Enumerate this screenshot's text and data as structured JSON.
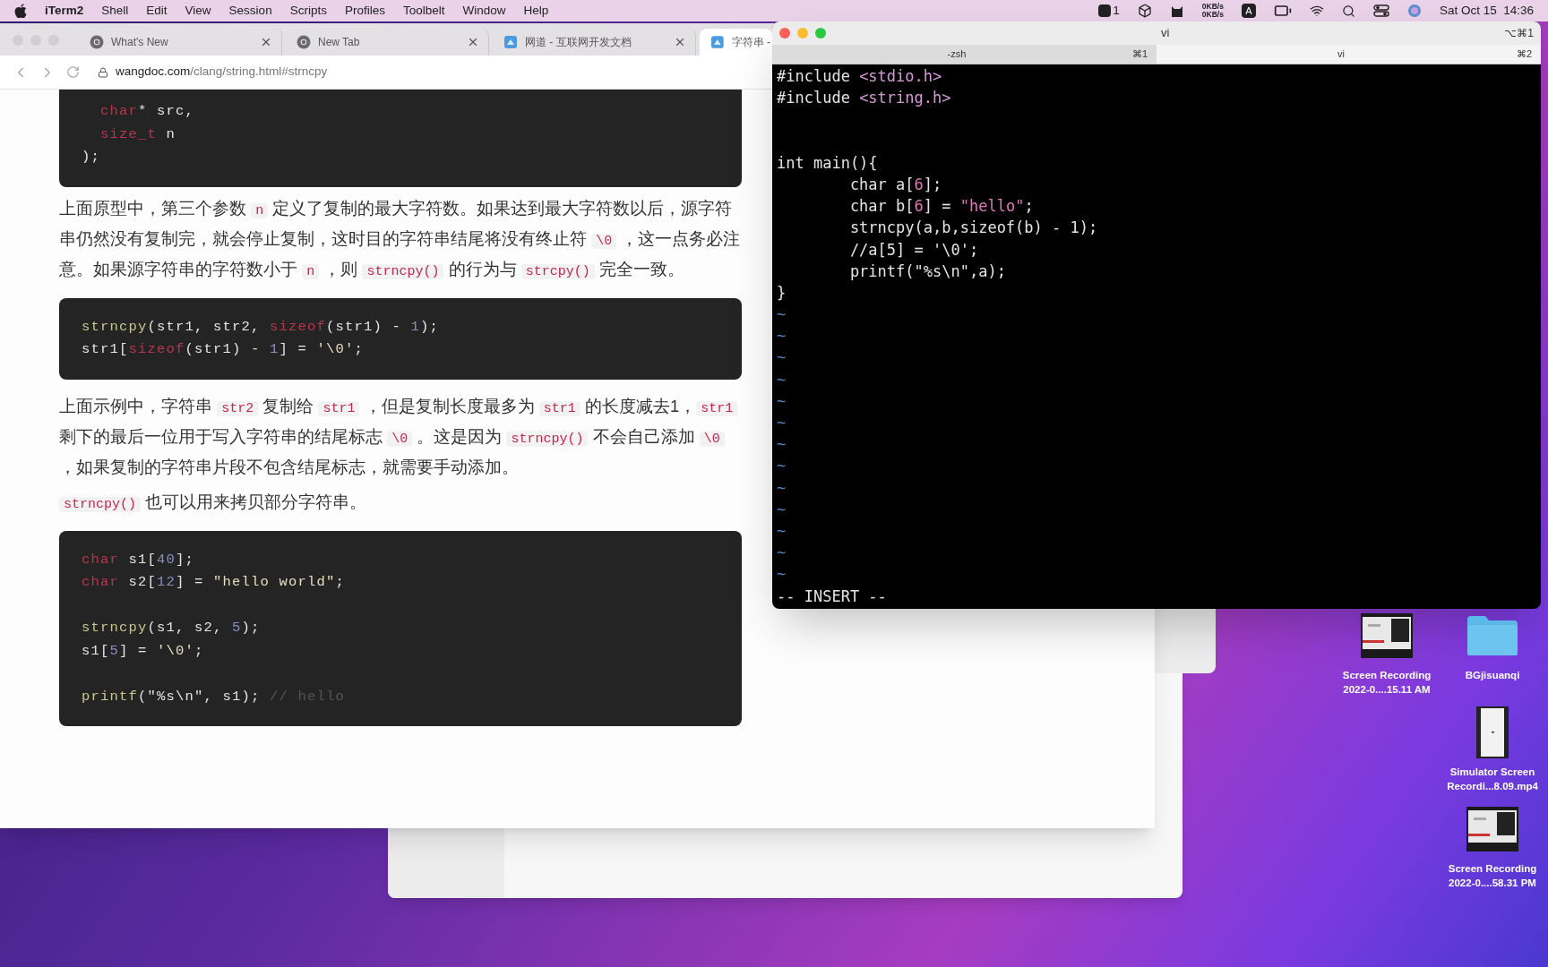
{
  "menu_bar": {
    "app": "iTerm2",
    "menus": [
      "Shell",
      "Edit",
      "View",
      "Session",
      "Scripts",
      "Profiles",
      "Toolbelt",
      "Window",
      "Help"
    ],
    "badge": "1",
    "net_up": "0KB/s",
    "net_down": "0KB/s",
    "keyboard": "A",
    "clock": "Sat Oct 15  14:36"
  },
  "browser": {
    "tabs": [
      {
        "title": "What's New",
        "kind": "chrome",
        "selected": false
      },
      {
        "title": "New Tab",
        "kind": "chrome",
        "selected": false
      },
      {
        "title": "网道 - 互联网开发文档",
        "kind": "doc",
        "selected": false
      },
      {
        "title": "字符串 -",
        "kind": "doc",
        "selected": true
      }
    ],
    "url_host": "wangdoc.com",
    "url_path": "/clang/string.html#strncpy",
    "blocks": [
      {
        "kind": "code",
        "groups": [
          [
            [
              {
                "text": "  char",
                "kind": "kw"
              },
              {
                "text": "* src,",
                "kind": "p"
              }
            ],
            [
              {
                "text": "  size_t",
                "kind": "kw"
              },
              {
                "text": " n",
                "kind": "p"
              }
            ],
            [
              {
                "text": ");",
                "kind": "p"
              }
            ]
          ]
        ]
      },
      {
        "kind": "paragraph",
        "segments": [
          {
            "text": "上面原型中，第三个参数 ",
            "kind": "text"
          },
          {
            "text": "n",
            "kind": "code"
          },
          {
            "text": " 定义了复制的最大字符数。如果达到最大字符数以后，源字符串仍然没有复制完，就会停止复制，这时目的字符串结尾将没有终止符 ",
            "kind": "text"
          },
          {
            "text": "\\0",
            "kind": "code"
          },
          {
            "text": " ，这一点务必注意。如果源字符串的字符数小于 ",
            "kind": "text"
          },
          {
            "text": "n",
            "kind": "code"
          },
          {
            "text": " ，则 ",
            "kind": "text"
          },
          {
            "text": "strncpy()",
            "kind": "code"
          },
          {
            "text": " 的行为与 ",
            "kind": "text"
          },
          {
            "text": "strcpy()",
            "kind": "code"
          },
          {
            "text": " 完全一致。",
            "kind": "text"
          }
        ]
      },
      {
        "kind": "code",
        "groups": [
          [
            [
              {
                "text": "strncpy",
                "kind": "fn"
              },
              {
                "text": "(str1, str2, ",
                "kind": "p"
              },
              {
                "text": "sizeof",
                "kind": "kw"
              },
              {
                "text": "(str1) - ",
                "kind": "p"
              },
              {
                "text": "1",
                "kind": "num"
              },
              {
                "text": ");",
                "kind": "p"
              }
            ],
            [
              {
                "text": "str1[",
                "kind": "p"
              },
              {
                "text": "sizeof",
                "kind": "kw"
              },
              {
                "text": "(str1) - ",
                "kind": "p"
              },
              {
                "text": "1",
                "kind": "num"
              },
              {
                "text": "] = ",
                "kind": "p"
              },
              {
                "text": "'\\0'",
                "kind": "str"
              },
              {
                "text": ";",
                "kind": "p"
              }
            ]
          ]
        ]
      },
      {
        "kind": "paragraph",
        "segments": [
          {
            "text": "上面示例中，字符串 ",
            "kind": "text"
          },
          {
            "text": "str2",
            "kind": "code"
          },
          {
            "text": " 复制给 ",
            "kind": "text"
          },
          {
            "text": "str1",
            "kind": "code"
          },
          {
            "text": " ，但是复制长度最多为 ",
            "kind": "text"
          },
          {
            "text": "str1",
            "kind": "code"
          },
          {
            "text": " 的长度减去1，",
            "kind": "text"
          },
          {
            "text": "str1",
            "kind": "code"
          },
          {
            "text": " 剩下的最后一位用于写入字符串的结尾标志 ",
            "kind": "text"
          },
          {
            "text": "\\0",
            "kind": "code"
          },
          {
            "text": " 。这是因为 ",
            "kind": "text"
          },
          {
            "text": "strncpy()",
            "kind": "code"
          },
          {
            "text": " 不会自己添加 ",
            "kind": "text"
          },
          {
            "text": "\\0",
            "kind": "code"
          },
          {
            "text": " ，如果复制的字符串片段不包含结尾标志，就需要手动添加。",
            "kind": "text"
          }
        ]
      },
      {
        "kind": "paragraph",
        "segments": [
          {
            "text": "strncpy()",
            "kind": "code"
          },
          {
            "text": " 也可以用来拷贝部分字符串。",
            "kind": "text"
          }
        ]
      },
      {
        "kind": "code",
        "groups": [
          [
            [
              {
                "text": "char",
                "kind": "kw"
              },
              {
                "text": " s1[",
                "kind": "p"
              },
              {
                "text": "40",
                "kind": "num"
              },
              {
                "text": "];",
                "kind": "p"
              }
            ],
            [
              {
                "text": "char",
                "kind": "kw"
              },
              {
                "text": " s2[",
                "kind": "p"
              },
              {
                "text": "12",
                "kind": "num"
              },
              {
                "text": "] = ",
                "kind": "p"
              },
              {
                "text": "\"hello world\"",
                "kind": "str"
              },
              {
                "text": ";",
                "kind": "p"
              }
            ]
          ],
          [
            [
              {
                "text": "strncpy",
                "kind": "fn"
              },
              {
                "text": "(s1, s2, ",
                "kind": "p"
              },
              {
                "text": "5",
                "kind": "num"
              },
              {
                "text": ");",
                "kind": "p"
              }
            ],
            [
              {
                "text": "s1[",
                "kind": "p"
              },
              {
                "text": "5",
                "kind": "num"
              },
              {
                "text": "] = ",
                "kind": "p"
              },
              {
                "text": "'\\0'",
                "kind": "str"
              },
              {
                "text": ";",
                "kind": "p"
              }
            ]
          ],
          [
            [
              {
                "text": "printf",
                "kind": "fn"
              },
              {
                "text": "(\"%s\\n\", s1); ",
                "kind": "p"
              },
              {
                "text": "// hello",
                "kind": "cm"
              }
            ]
          ]
        ]
      }
    ]
  },
  "terminal": {
    "title": "vi",
    "shortcut": "⌥⌘1",
    "tabs": [
      {
        "label": "-zsh",
        "shortcut": "⌘1",
        "selected": false
      },
      {
        "label": "vi",
        "shortcut": "⌘2",
        "selected": true
      }
    ],
    "groups": [
      [
        [
          {
            "text": "#include ",
            "kind": "p"
          },
          {
            "text": "<stdio.h>",
            "kind": "hdr"
          }
        ],
        [
          {
            "text": "#include ",
            "kind": "p"
          },
          {
            "text": "<string.h>",
            "kind": "hdr"
          }
        ]
      ],
      [
        [
          {
            "text": "int main(){",
            "kind": "p"
          }
        ],
        [
          {
            "text": "        char a[",
            "kind": "p"
          },
          {
            "text": "6",
            "kind": "num"
          },
          {
            "text": "];",
            "kind": "p"
          }
        ],
        [
          {
            "text": "        char b[",
            "kind": "p"
          },
          {
            "text": "6",
            "kind": "num"
          },
          {
            "text": "] = ",
            "kind": "p"
          },
          {
            "text": "\"hello\"",
            "kind": "str"
          },
          {
            "text": ";",
            "kind": "p"
          }
        ],
        [
          {
            "text": "        strncpy(a,b,sizeof(b) - 1);",
            "kind": "p"
          }
        ],
        [
          {
            "text": "        //a[5] = '\\0';",
            "kind": "p"
          }
        ],
        [
          {
            "text": "        printf(\"%s\\n\",a);",
            "kind": "p"
          }
        ],
        [
          {
            "text": "}",
            "kind": "p"
          }
        ]
      ]
    ],
    "empty_lines": [
      "~",
      "~",
      "~",
      "~",
      "~",
      "~",
      "~",
      "~",
      "~",
      "~",
      "~",
      "~",
      "~"
    ],
    "mode": "-- INSERT --"
  },
  "desktop_icons": [
    {
      "kind": "recording",
      "lines": [
        "Screen Recording",
        "2022-0....15.11 AM"
      ]
    },
    {
      "kind": "folder",
      "lines": [
        "BGjisuanqi"
      ]
    },
    {
      "kind": "phone_video",
      "lines": [
        "Simulator Screen",
        "Recordi...8.09.mp4"
      ]
    },
    {
      "kind": "recording",
      "lines": [
        "Screen Recording",
        "2022-0....58.31 PM"
      ]
    }
  ]
}
